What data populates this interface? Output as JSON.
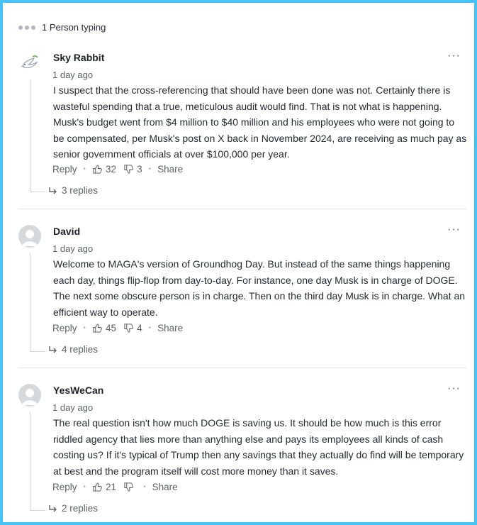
{
  "typing": {
    "text": "1 Person typing"
  },
  "comments": [
    {
      "author": "Sky Rabbit",
      "time": "1 day ago",
      "avatar": "dove-icon",
      "text": "I suspect that the cross-referencing that should have been done was not. Certainly there is wasteful spending that a true, meticulous audit would find. That is not what is happening. Musk's budget went from $4 million to $40 million and his employees who were not going to be compensated, per Musk's post on X back in November 2024, are receiving as much pay as senior government officials at over $100,000 per year.",
      "reply_label": "Reply",
      "likes": "32",
      "dislikes": "3",
      "share_label": "Share",
      "replies": "3 replies"
    },
    {
      "author": "David",
      "time": "1 day ago",
      "avatar": "default-avatar-icon",
      "text": "Welcome to MAGA's version of Groundhog Day. But instead of the same things happening each day, things flip-flop from day-to-day. For instance, one day Musk is in charge of DOGE. The next some obscure person is in charge. Then on the third day Musk is in charge. What an efficient way to operate.",
      "reply_label": "Reply",
      "likes": "45",
      "dislikes": "4",
      "share_label": "Share",
      "replies": "4 replies"
    },
    {
      "author": "YesWeCan",
      "time": "1 day ago",
      "avatar": "default-avatar-icon",
      "text": "The real question isn't how much DOGE is saving us.  It should be how much is this error riddled agency that lies more than anything else and pays its employees all kinds of cash costing us?  If it's typical of Trump then any savings that they actually do find will be temporary at best and the program itself will cost more money than it saves.",
      "reply_label": "Reply",
      "likes": "21",
      "dislikes": "",
      "share_label": "Share",
      "replies": "2 replies"
    }
  ],
  "more_menu": "···",
  "colors": {
    "frame": "#45c3f5",
    "text": "#232a31",
    "muted": "#5b636a",
    "divider": "#e0e4e9"
  }
}
